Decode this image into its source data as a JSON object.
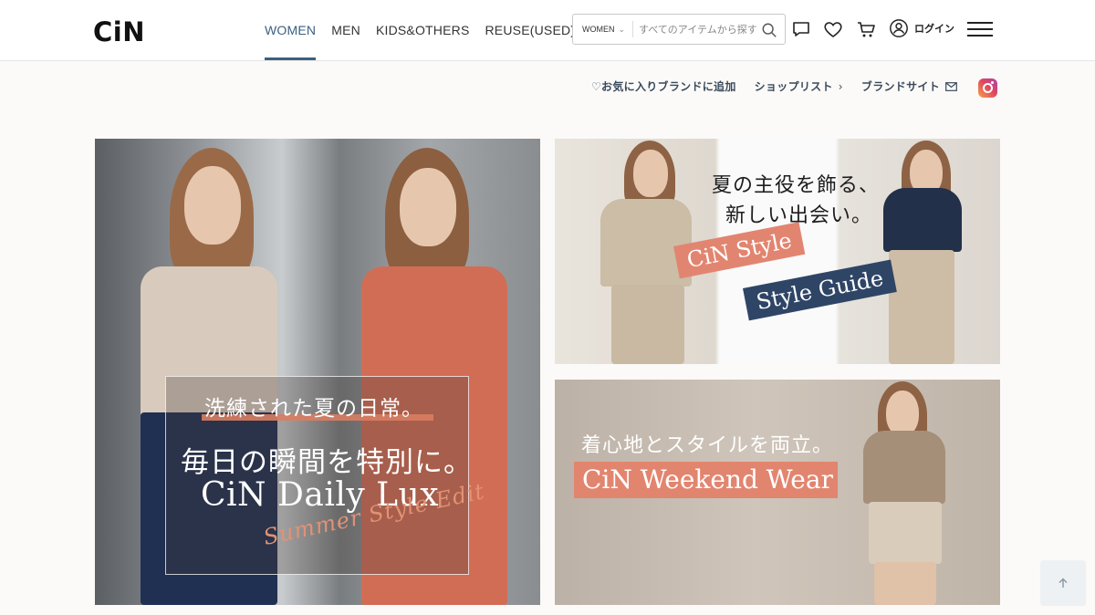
{
  "header": {
    "logo": "CiN",
    "nav": [
      "WOMEN",
      "MEN",
      "KIDS&OTHERS",
      "REUSE(USED)"
    ],
    "active_nav": "WOMEN",
    "search": {
      "scope": "WOMEN",
      "placeholder": "すべてのアイテムから探す"
    },
    "login_label": "ログイン",
    "icons": [
      "chat-icon",
      "heart-icon",
      "cart-icon",
      "user-icon",
      "menu-icon"
    ]
  },
  "sublinks": {
    "favorite": "♡お気に入りブランドに追加",
    "shoplist": "ショップリスト",
    "brandsite": "ブランドサイト"
  },
  "banners": {
    "main": {
      "subtitle": "洗練された夏の日常。",
      "title_jp": "毎日の瞬間を特別に。",
      "title_en": "CiN Daily Lux",
      "script": "Summer Style Edit"
    },
    "top_right": {
      "catch_line1": "夏の主役を飾る、",
      "catch_line2": "新しい出会い。",
      "tag1": "CiN Style",
      "tag2": "Style Guide"
    },
    "bottom_right": {
      "catch": "着心地とスタイルを両立。",
      "tag": "CiN Weekend Wear"
    }
  },
  "colors": {
    "accent_nav": "#3b5f80",
    "tag_coral": "#e28570",
    "tag_navy": "#2f4566"
  }
}
